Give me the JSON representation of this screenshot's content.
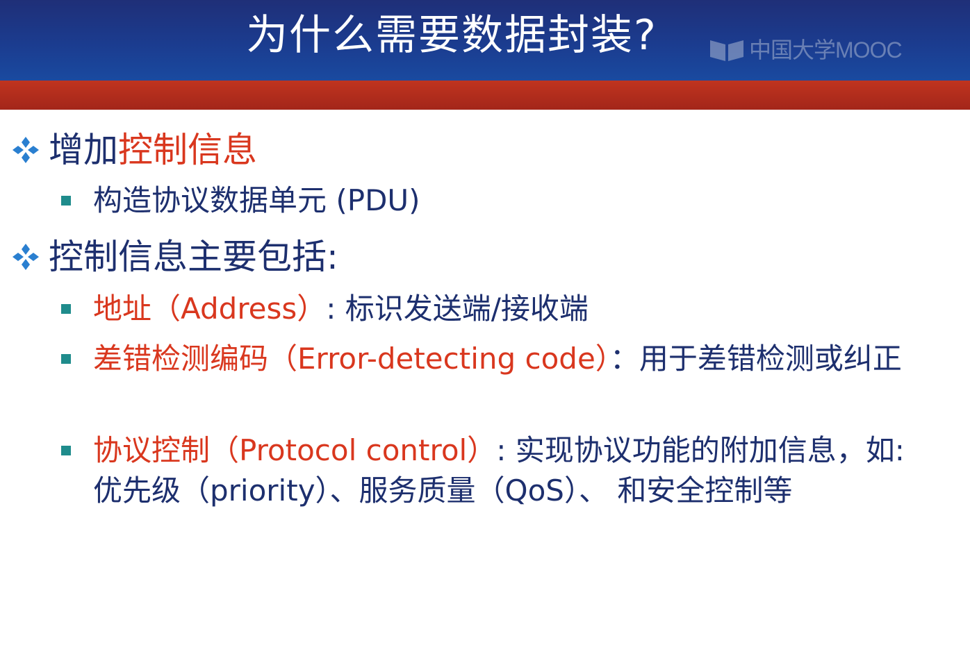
{
  "slide": {
    "title": "为什么需要数据封装?",
    "watermark": "中国大学MOOC"
  },
  "points": [
    {
      "prefix": "增加",
      "highlight": "控制信息",
      "sub": [
        {
          "text": "构造协议数据单元 (PDU)"
        }
      ]
    },
    {
      "prefix": "控制信息主要包括:",
      "highlight": "",
      "sub": [
        {
          "term": "地址（Address）",
          "desc": ": 标识发送端/接收端"
        },
        {
          "term": "差错检测编码（Error-detecting code）",
          "desc": "：用于差错检测或纠正"
        },
        {
          "term": "协议控制（Protocol control）",
          "desc": ": 实现协议功能的附加信息，如: 优先级（priority）、服务质量（QoS）、 和安全控制等"
        }
      ]
    }
  ],
  "colors": {
    "header": "#1b3c8f",
    "band": "#a3261a",
    "text": "#1d2f6e",
    "highlight": "#d9371e",
    "bullet_l1": "#2a7fd0",
    "bullet_l2": "#1f8c8c"
  },
  "icons": {
    "level1_bullet": "diamond-cluster-icon",
    "level2_bullet": "square-bullet-icon",
    "watermark_logo": "book-logo-icon"
  }
}
